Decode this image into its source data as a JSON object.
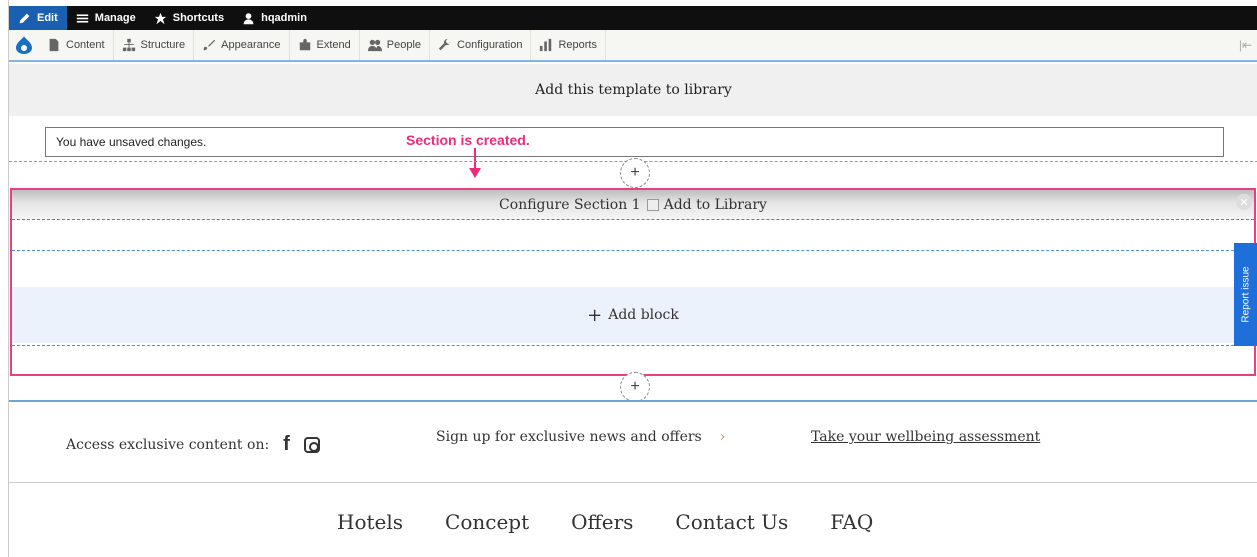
{
  "toolbar": {
    "edit": "Edit",
    "manage": "Manage",
    "shortcuts": "Shortcuts",
    "user": "hqadmin"
  },
  "tray": {
    "items": [
      "Content",
      "Structure",
      "Appearance",
      "Extend",
      "People",
      "Configuration",
      "Reports"
    ]
  },
  "header": {
    "title": "Add this template to library"
  },
  "messages": {
    "unsaved": "You have unsaved changes."
  },
  "annotation": {
    "text": "Section is created."
  },
  "section": {
    "configure": "Configure Section 1",
    "add_to_library": "Add to Library",
    "add_block": "Add block"
  },
  "report": {
    "label": "Report issue"
  },
  "footer": {
    "access": "Access exclusive content on:",
    "signup": "Sign up for exclusive news and offers",
    "signup_chevron": "›",
    "wellbeing": "Take your wellbeing assessment",
    "nav": [
      "Hotels",
      "Concept",
      "Offers",
      "Contact Us",
      "FAQ"
    ]
  },
  "colors": {
    "accent_pink": "#e8407f",
    "admin_blue": "#1b5fb0",
    "region_blue": "#4a90d9"
  }
}
